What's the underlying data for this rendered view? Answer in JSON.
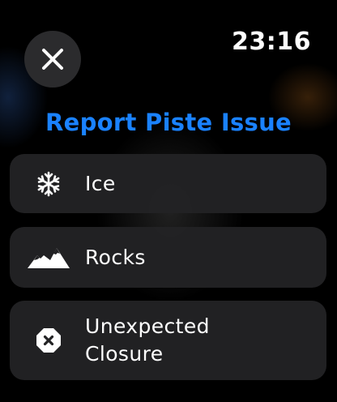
{
  "status_bar": {
    "time": "23:16"
  },
  "header": {
    "close_icon": "xmark-icon",
    "title": "Report Piste Issue"
  },
  "colors": {
    "title": "#1a82ff",
    "row_background": "#222224",
    "close_button_background": "#2b2b2d"
  },
  "options": [
    {
      "label": "Ice",
      "icon": "snowflake-icon"
    },
    {
      "label": "Rocks",
      "icon": "mountains-icon"
    },
    {
      "label": "Unexpected\nClosure",
      "icon": "xmark-octagon-icon"
    }
  ]
}
